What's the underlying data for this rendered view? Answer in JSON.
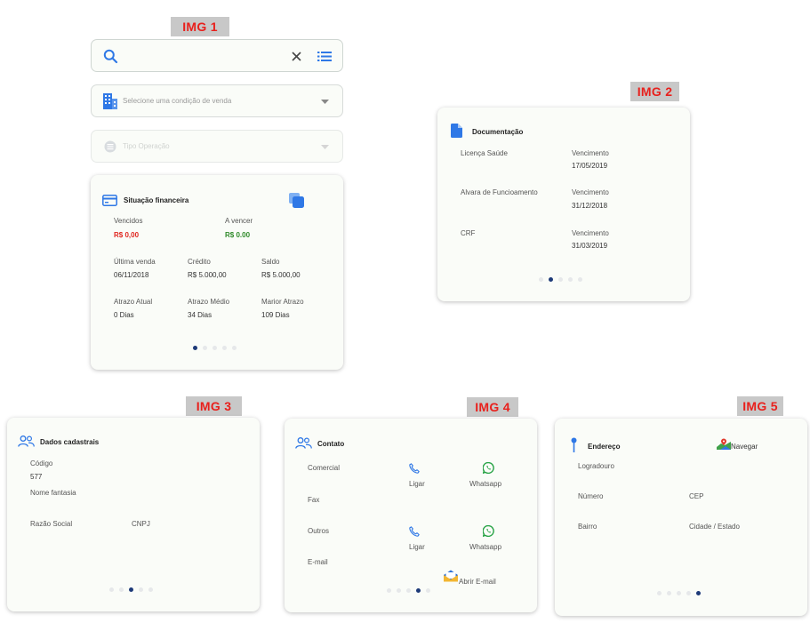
{
  "panels": {
    "img1": {
      "tag": "IMG 1",
      "search": {
        "placeholder": ""
      },
      "condicao_placeholder": "Selecione uma condição de venda",
      "tipo_placeholder": "Tipo Operação",
      "card": {
        "title": "Situação financeira",
        "vencidos_label": "Vencidos",
        "vencidos_value": "R$ 0,00",
        "avencer_label": "A vencer",
        "avencer_value": "R$ 0.00",
        "ultima_label": "Última venda",
        "ultima_value": "06/11/2018",
        "credito_label": "Crédito",
        "credito_value": "R$ 5.000,00",
        "saldo_label": "Saldo",
        "saldo_value": "R$ 5.000,00",
        "atual_label": "Atrazo Atual",
        "atual_value": "0 Dias",
        "medio_label": "Atrazo Médio",
        "medio_value": "34 Dias",
        "maior_label": "Marior Atrazo",
        "maior_value": "109 Dias"
      }
    },
    "img2": {
      "tag": "IMG 2",
      "title": "Documentação",
      "docs": [
        {
          "name": "Licença Saúde",
          "due_label": "Vencimento",
          "due": "17/05/2019"
        },
        {
          "name": "Alvara de Funcioamento",
          "due_label": "Vencimento",
          "due": "31/12/2018"
        },
        {
          "name": "CRF",
          "due_label": "Vencimento",
          "due": "31/03/2019"
        }
      ]
    },
    "img3": {
      "tag": "IMG 3",
      "title": "Dados cadastrais",
      "codigo_label": "Código",
      "codigo_value": "577",
      "fantasia_label": "Nome fantasia",
      "razao_label": "Razão Social",
      "cnpj_label": "CNPJ"
    },
    "img4": {
      "tag": "IMG 4",
      "title": "Contato",
      "comercial_label": "Comercial",
      "ligar1": "Ligar",
      "whatsapp1": "Whatsapp",
      "fax_label": "Fax",
      "outros_label": "Outros",
      "ligar2": "Ligar",
      "whatsapp2": "Whatsapp",
      "email_label": "E-mail",
      "email_action": "Abrir E-mail"
    },
    "img5": {
      "tag": "IMG 5",
      "title": "Endereço",
      "navegar": "Navegar",
      "logradouro_label": "Logradouro",
      "numero_label": "Número",
      "cep_label": "CEP",
      "bairro_label": "Bairro",
      "cidade_label": "Cidade / Estado"
    }
  },
  "colors": {
    "accent_blue": "#2f78e6",
    "dot_active": "#1d3a78",
    "red_value": "#e0261f",
    "green_value": "#2f8a2a",
    "whatsapp_green": "#25a244",
    "tag_text": "#e8201c",
    "tag_bg": "#c8c8c8"
  },
  "carousel": {
    "img1": {
      "count": 5,
      "active": 1
    },
    "img2": {
      "count": 5,
      "active": 2
    },
    "img3": {
      "count": 5,
      "active": 3
    },
    "img4": {
      "count": 5,
      "active": 4
    },
    "img5": {
      "count": 5,
      "active": 5
    }
  }
}
